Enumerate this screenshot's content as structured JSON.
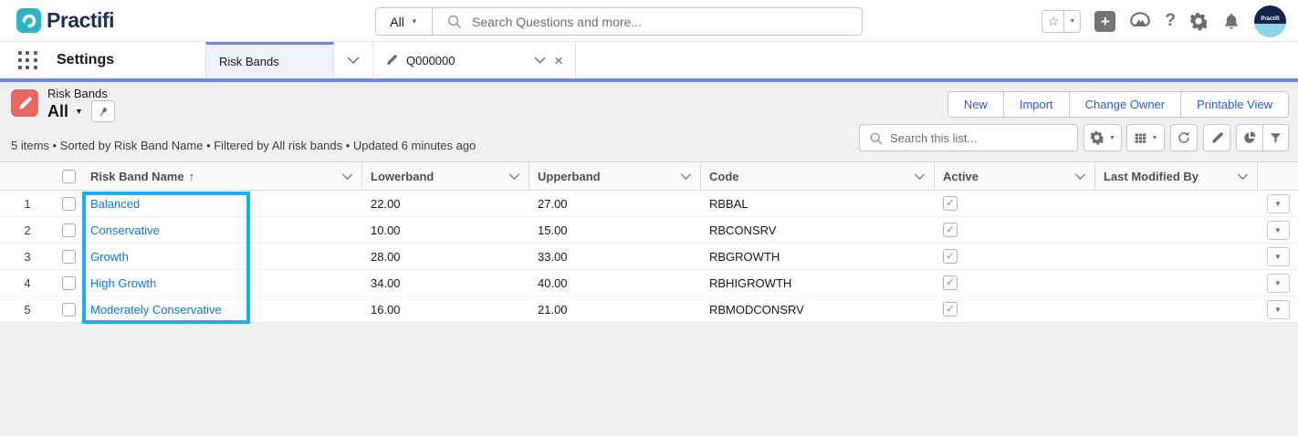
{
  "icons": {
    "caret_down": "▼",
    "star": "☆",
    "plus": "+",
    "help": "?",
    "close": "×",
    "sort_ascending": "↑",
    "checkmark": "✓"
  },
  "colors": {
    "brand_bar": "#7486d9",
    "highlight_box": "#1ab0eb",
    "object_icon": "#e8695f",
    "link": "#0b78d2",
    "logo_teal": "#2bb5c4",
    "logo_navy": "#1b2f5e"
  },
  "top_bar": {
    "logo_text": "Practifi",
    "search_scope": "All",
    "search_placeholder": "Search Questions and more...",
    "avatar_label": "Practifi"
  },
  "nav_bar": {
    "app_name": "Settings",
    "tabs": [
      {
        "label": "Risk Bands",
        "active": true
      },
      {
        "label": "Q000000",
        "active": false
      }
    ]
  },
  "page_header": {
    "object_label": "Risk Bands",
    "list_view_label": "All",
    "actions": [
      "New",
      "Import",
      "Change Owner",
      "Printable View"
    ],
    "status_line": "5 items • Sorted by Risk Band Name • Filtered by All risk bands • Updated 6 minutes ago",
    "list_search_placeholder": "Search this list..."
  },
  "table": {
    "columns": [
      {
        "label": "Risk Band Name",
        "sorted": "ascending"
      },
      {
        "label": "Lowerband"
      },
      {
        "label": "Upperband"
      },
      {
        "label": "Code"
      },
      {
        "label": "Active"
      },
      {
        "label": "Last Modified By"
      }
    ],
    "rows": [
      {
        "num": "1",
        "name": "Balanced",
        "lowerband": "22.00",
        "upperband": "27.00",
        "code": "RBBAL",
        "active": true,
        "last_modified_by": ""
      },
      {
        "num": "2",
        "name": "Conservative",
        "lowerband": "10.00",
        "upperband": "15.00",
        "code": "RBCONSRV",
        "active": true,
        "last_modified_by": ""
      },
      {
        "num": "3",
        "name": "Growth",
        "lowerband": "28.00",
        "upperband": "33.00",
        "code": "RBGROWTH",
        "active": true,
        "last_modified_by": ""
      },
      {
        "num": "4",
        "name": "High Growth",
        "lowerband": "34.00",
        "upperband": "40.00",
        "code": "RBHIGROWTH",
        "active": true,
        "last_modified_by": ""
      },
      {
        "num": "5",
        "name": "Moderately Conservative",
        "lowerband": "16.00",
        "upperband": "21.00",
        "code": "RBMODCONSRV",
        "active": true,
        "last_modified_by": ""
      }
    ]
  }
}
